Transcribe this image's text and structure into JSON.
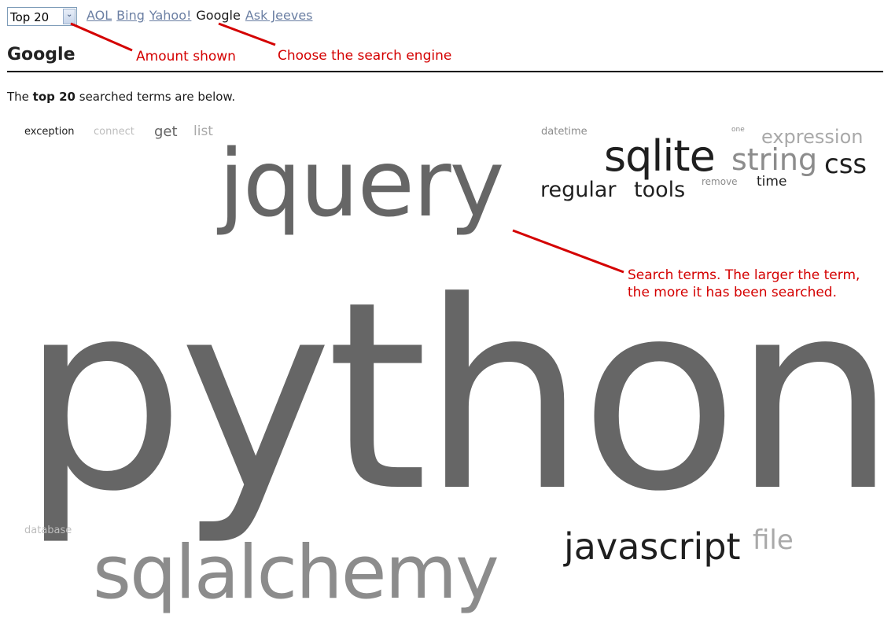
{
  "controls": {
    "amount_select_value": "Top 20",
    "dropdown_icon": "chevron-down-icon"
  },
  "engines": {
    "aol": "AOL",
    "bing": "Bing",
    "yahoo": "Yahoo!",
    "google": "Google",
    "ask": "Ask Jeeves"
  },
  "page": {
    "title": "Google",
    "intro_prefix": "The ",
    "intro_bold": "top 20",
    "intro_suffix": " searched terms are below."
  },
  "cloud": {
    "exception": "exception",
    "connect": "connect",
    "get": "get",
    "list": "list",
    "datetime": "datetime",
    "one": "one",
    "expression": "expression",
    "sqlite": "sqlite",
    "string": "string",
    "css": "css",
    "regular": "regular",
    "tools": "tools",
    "remove": "remove",
    "time": "time",
    "jquery": "jquery",
    "python": "python",
    "database": "database",
    "javascript": "javascript",
    "file": "file",
    "sqlalchemy": "sqlalchemy"
  },
  "annotations": {
    "amount": "Amount shown",
    "engine": "Choose the search engine",
    "terms": "Search terms. The larger the term, the more it has been searched."
  },
  "colors": {
    "annotation": "#d40000",
    "link": "#6b7fa3"
  }
}
